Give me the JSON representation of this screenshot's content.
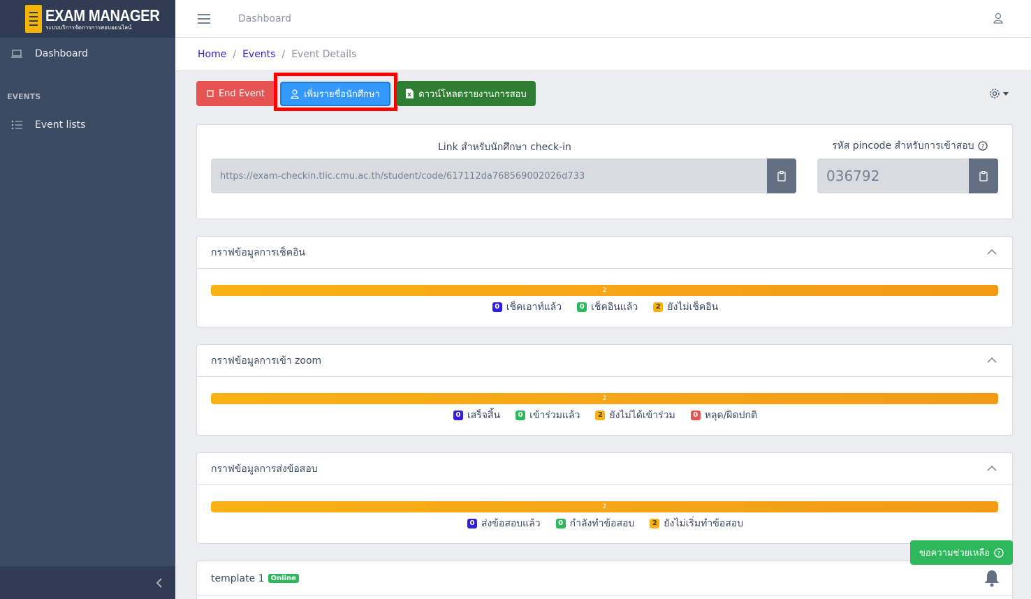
{
  "brand": {
    "title": "EXAM MANAGER",
    "subtitle": "ระบบบริการจัดการการสอบออนไลน์"
  },
  "sidebar": {
    "items": [
      {
        "label": "Dashboard",
        "icon": "laptop-icon"
      }
    ],
    "section_title": "EVENTS",
    "section_items": [
      {
        "label": "Event lists",
        "icon": "list-icon"
      }
    ]
  },
  "header": {
    "link": "Dashboard"
  },
  "breadcrumb": {
    "home": "Home",
    "events": "Events",
    "current": "Event Details"
  },
  "toolbar": {
    "end_event": "End Event",
    "add_students": "เพิ่มรายชื่อนักศึกษา",
    "download_report": "ดาวน์โหลดรายงานการสอบ"
  },
  "link_card": {
    "link_label": "Link สำหรับนักศึกษา check-in",
    "link_value": "https://exam-checkin.tlic.cmu.ac.th/student/code/617112da768569002026d733",
    "pincode_label": "รหัส pincode สำหรับการเข้าสอบ",
    "pincode_value": "036792"
  },
  "checkin_card": {
    "title": "กราฟข้อมูลการเช็คอิน",
    "bar_value": "2",
    "legend": [
      {
        "count": "0",
        "label": "เช็คเอาท์แล้ว",
        "color": "#321fdb"
      },
      {
        "count": "0",
        "label": "เช็คอินแล้ว",
        "color": "#2eb85c"
      },
      {
        "count": "2",
        "label": "ยังไม่เช็คอิน",
        "color": "#f9b115"
      }
    ]
  },
  "zoom_card": {
    "title": "กราฟข้อมูลการเข้า zoom",
    "bar_value": "2",
    "legend": [
      {
        "count": "0",
        "label": "เสร็จสิ้น",
        "color": "#321fdb"
      },
      {
        "count": "0",
        "label": "เข้าร่วมแล้ว",
        "color": "#2eb85c"
      },
      {
        "count": "2",
        "label": "ยังไม่ได้เข้าร่วม",
        "color": "#f9b115"
      },
      {
        "count": "0",
        "label": "หลุด/ผิดปกติ",
        "color": "#e55353"
      }
    ]
  },
  "submit_card": {
    "title": "กราฟข้อมูลการส่งข้อสอบ",
    "bar_value": "2",
    "legend": [
      {
        "count": "0",
        "label": "ส่งข้อสอบแล้ว",
        "color": "#321fdb"
      },
      {
        "count": "0",
        "label": "กำลังทำข้อสอบ",
        "color": "#2eb85c"
      },
      {
        "count": "2",
        "label": "ยังไม่เริ่มทำข้อสอบ",
        "color": "#f9b115"
      }
    ]
  },
  "template_card": {
    "title": "template 1",
    "badge": "Online"
  },
  "help_button": "ขอความช่วยเหลือ"
}
